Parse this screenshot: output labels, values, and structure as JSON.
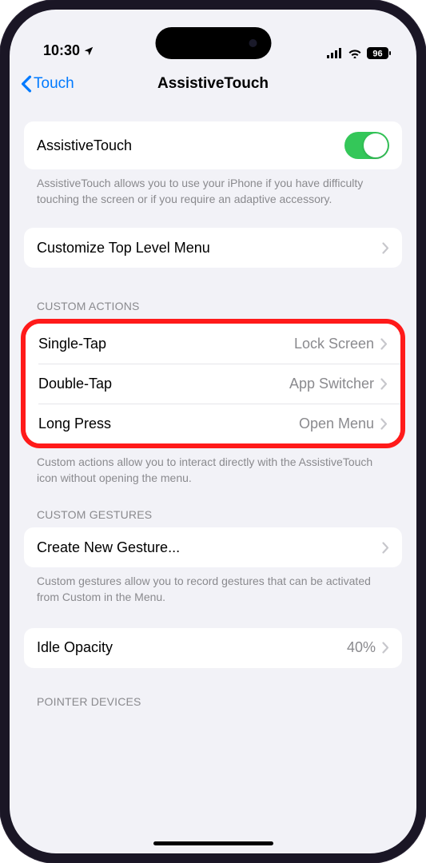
{
  "status": {
    "time": "10:30",
    "battery": "96"
  },
  "nav": {
    "back_label": "Touch",
    "title": "AssistiveTouch"
  },
  "main_toggle": {
    "label": "AssistiveTouch",
    "footer": "AssistiveTouch allows you to use your iPhone if you have difficulty touching the screen or if you require an adaptive accessory."
  },
  "customize_menu": {
    "label": "Customize Top Level Menu"
  },
  "custom_actions": {
    "header": "CUSTOM ACTIONS",
    "rows": [
      {
        "label": "Single-Tap",
        "value": "Lock Screen"
      },
      {
        "label": "Double-Tap",
        "value": "App Switcher"
      },
      {
        "label": "Long Press",
        "value": "Open Menu"
      }
    ],
    "footer": "Custom actions allow you to interact directly with the AssistiveTouch icon without opening the menu."
  },
  "custom_gestures": {
    "header": "CUSTOM GESTURES",
    "label": "Create New Gesture...",
    "footer": "Custom gestures allow you to record gestures that can be activated from Custom in the Menu."
  },
  "idle_opacity": {
    "label": "Idle Opacity",
    "value": "40%"
  },
  "pointer_devices": {
    "header": "POINTER DEVICES"
  }
}
